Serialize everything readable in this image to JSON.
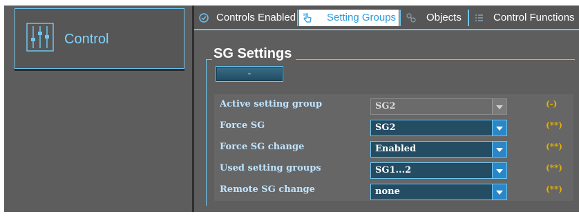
{
  "sidebar": {
    "control_tile": {
      "label": "Control",
      "icon": "sliders-icon"
    }
  },
  "tabs": [
    {
      "label": "Controls Enabled",
      "icon": "check-circle-icon",
      "active": false
    },
    {
      "label": "Setting Groups",
      "icon": "hand-pointer-icon",
      "active": true
    },
    {
      "label": "Objects",
      "icon": "objects-icon",
      "active": false
    },
    {
      "label": "Control Functions",
      "icon": "list-icon",
      "active": false
    }
  ],
  "group": {
    "title": "SG Settings",
    "button_label": "-",
    "rows": [
      {
        "label": "Active setting group",
        "value": "SG2",
        "note": "(-)",
        "disabled": true
      },
      {
        "label": "Force SG",
        "value": "SG2",
        "note": "(**)",
        "disabled": false
      },
      {
        "label": "Force SG change",
        "value": "Enabled",
        "note": "(**)",
        "disabled": false
      },
      {
        "label": "Used setting groups",
        "value": "SG1...2",
        "note": "(**)",
        "disabled": false
      },
      {
        "label": "Remote SG change",
        "value": "none",
        "note": "(**)",
        "disabled": false
      }
    ]
  },
  "colors": {
    "accent": "#6ec6f0",
    "panel_bg": "#5e5e5e",
    "note": "#e3b000",
    "label": "#bfe4ff"
  }
}
